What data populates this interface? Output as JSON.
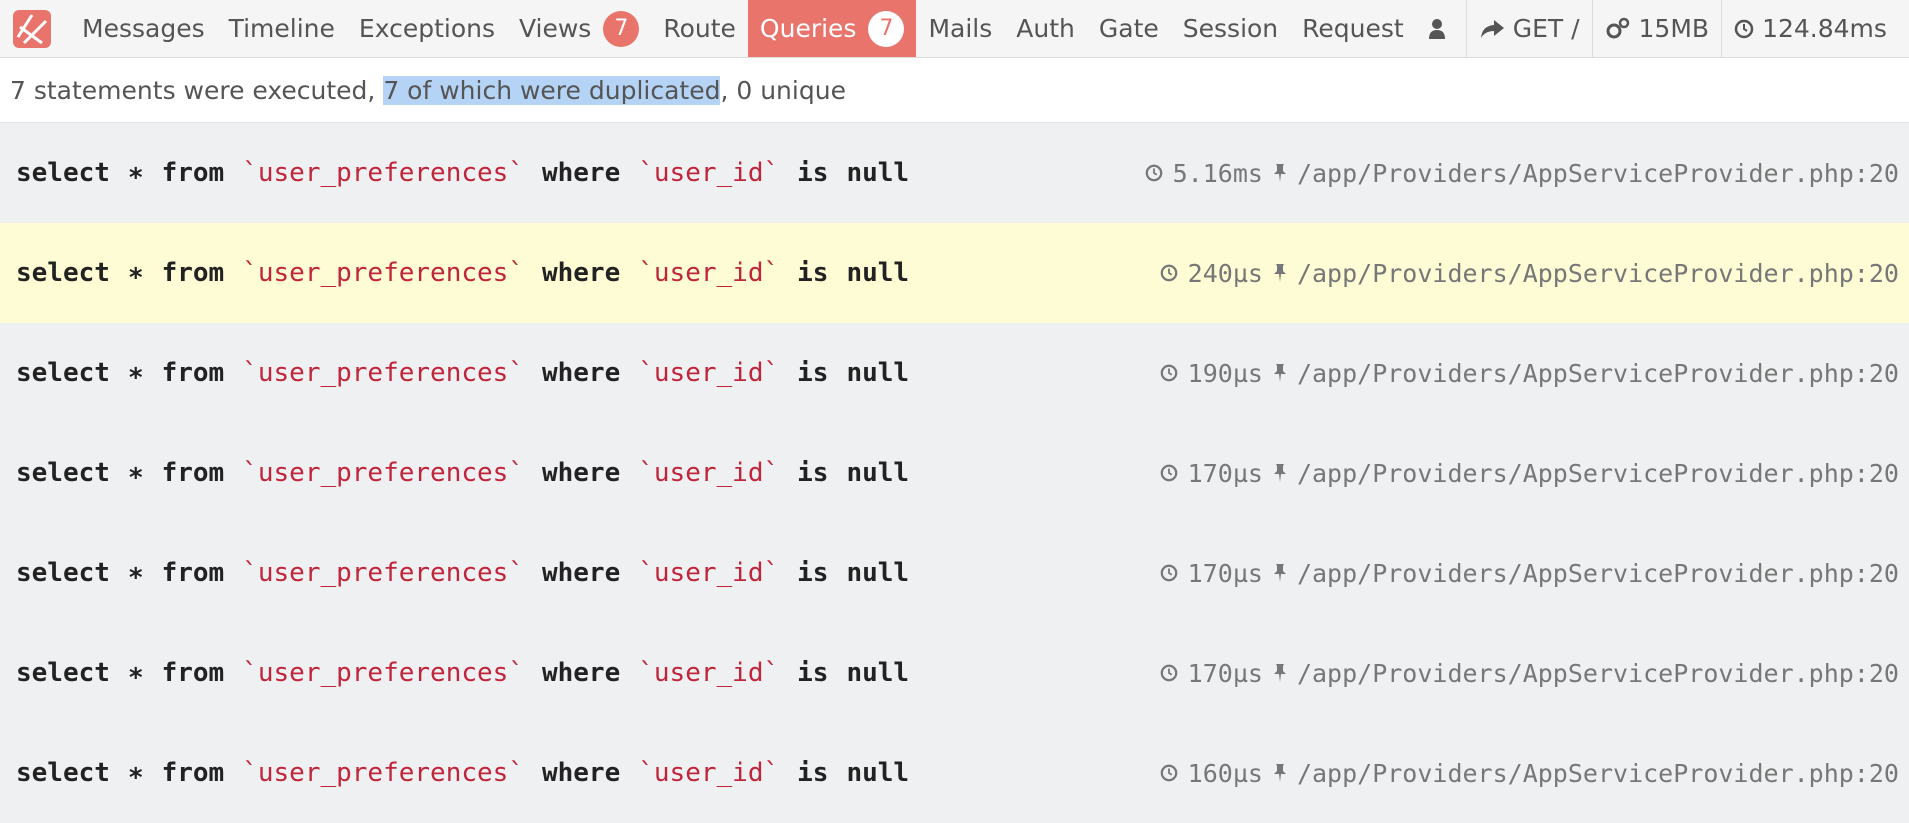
{
  "header": {
    "tabs": [
      {
        "label": "Messages",
        "badge": null,
        "active": false
      },
      {
        "label": "Timeline",
        "badge": null,
        "active": false
      },
      {
        "label": "Exceptions",
        "badge": null,
        "active": false
      },
      {
        "label": "Views",
        "badge": "7",
        "active": false
      },
      {
        "label": "Route",
        "badge": null,
        "active": false
      },
      {
        "label": "Queries",
        "badge": "7",
        "active": true
      },
      {
        "label": "Mails",
        "badge": null,
        "active": false
      },
      {
        "label": "Auth",
        "badge": null,
        "active": false
      },
      {
        "label": "Gate",
        "badge": null,
        "active": false
      },
      {
        "label": "Session",
        "badge": null,
        "active": false
      },
      {
        "label": "Request",
        "badge": null,
        "active": false
      }
    ],
    "request": "GET /",
    "memory": "15MB",
    "duration": "124.84ms"
  },
  "status": {
    "prefix": "7 statements were executed, ",
    "highlighted": "7 of which were duplicated",
    "suffix": ", 0 unique"
  },
  "queries": [
    {
      "time": "5.16ms",
      "source": "/app/Providers/AppServiceProvider.php:20"
    },
    {
      "time": "240µs",
      "source": "/app/Providers/AppServiceProvider.php:20"
    },
    {
      "time": "190µs",
      "source": "/app/Providers/AppServiceProvider.php:20"
    },
    {
      "time": "170µs",
      "source": "/app/Providers/AppServiceProvider.php:20"
    },
    {
      "time": "170µs",
      "source": "/app/Providers/AppServiceProvider.php:20"
    },
    {
      "time": "170µs",
      "source": "/app/Providers/AppServiceProvider.php:20"
    },
    {
      "time": "160µs",
      "source": "/app/Providers/AppServiceProvider.php:20"
    }
  ],
  "sql": {
    "select": "select",
    "star": "∗",
    "from": "from",
    "table": "`user_preferences`",
    "where": "where",
    "column": "`user_id`",
    "is": "is",
    "null": "null"
  },
  "colors": {
    "accent": "#e8746b",
    "identifier": "#c0253b",
    "highlighted_row": "#fdfcd5",
    "row_bg": "#eff0f2",
    "selection": "#b4d3f5"
  },
  "icons": {
    "logo": "laravel-logo-icon",
    "user": "user-icon",
    "request": "share-arrow-icon",
    "memory": "cogs-icon",
    "duration": "clock-icon",
    "query_time": "clock-icon",
    "query_source": "pin-icon"
  }
}
